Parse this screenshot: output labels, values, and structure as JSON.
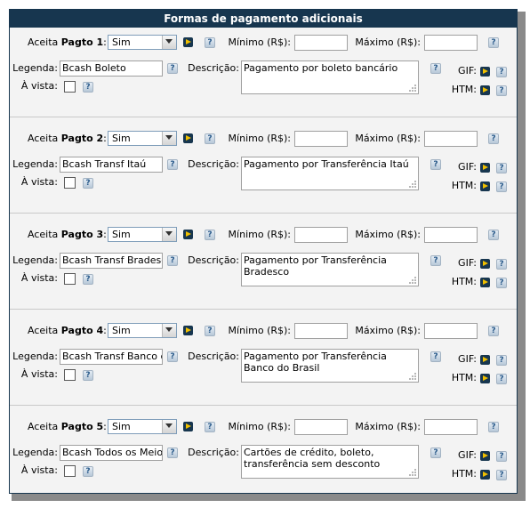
{
  "panel": {
    "title": "Formas de pagamento adicionais"
  },
  "labels": {
    "aceita": "Aceita",
    "pagto": "Pagto",
    "colon": ":",
    "minimo": "Mínimo (R$):",
    "maximo": "Máximo (R$):",
    "legenda": "Legenda:",
    "descricao": "Descrição:",
    "a_vista": "À vista:",
    "gif": "GIF:",
    "htm": "HTM:",
    "help": "?"
  },
  "colors": {
    "header_bg": "#17364f",
    "accent_arrow": "#f0c000"
  },
  "icons": {
    "go": "play-arrow-icon",
    "help": "help-icon"
  },
  "payments": [
    {
      "number": "1",
      "aceita": "Sim",
      "minimo": "",
      "maximo": "",
      "legenda": "Bcash Boleto",
      "descricao": "Pagamento por boleto bancário",
      "a_vista": false
    },
    {
      "number": "2",
      "aceita": "Sim",
      "minimo": "",
      "maximo": "",
      "legenda": "Bcash Transf Itaú",
      "descricao": "Pagamento por Transferência Itaú",
      "a_vista": false
    },
    {
      "number": "3",
      "aceita": "Sim",
      "minimo": "",
      "maximo": "",
      "legenda": "Bcash Transf Bradesco",
      "descricao": "Pagamento por Transferência Bradesco",
      "a_vista": false
    },
    {
      "number": "4",
      "aceita": "Sim",
      "minimo": "",
      "maximo": "",
      "legenda": "Bcash Transf  Banco do",
      "descricao": "Pagamento por Transferência Banco do Brasil",
      "a_vista": false
    },
    {
      "number": "5",
      "aceita": "Sim",
      "minimo": "",
      "maximo": "",
      "legenda": "Bcash Todos os Meios (",
      "descricao": "Cartões de crédito, boleto, transferência sem desconto",
      "a_vista": false
    }
  ]
}
